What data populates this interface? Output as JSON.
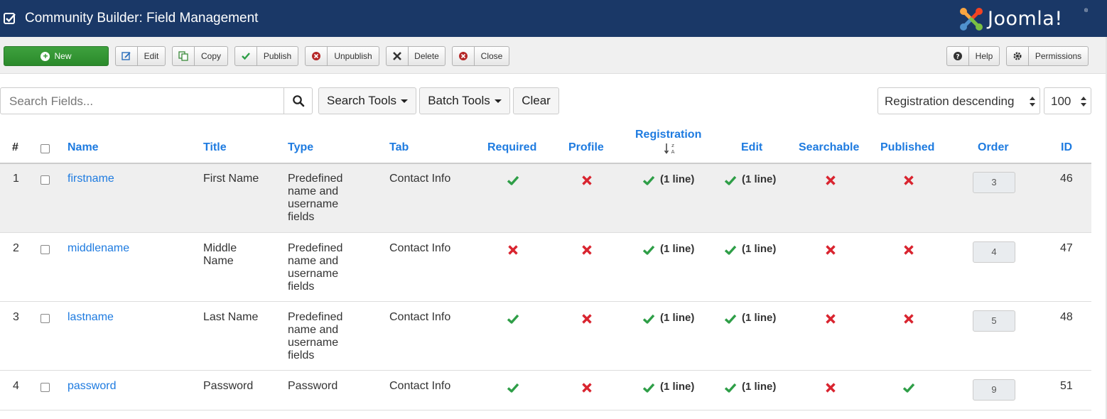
{
  "header": {
    "title": "Community Builder: Field Management",
    "logo_text": "Joomla!",
    "logo_reg": "®"
  },
  "toolbar": {
    "new": "New",
    "edit": "Edit",
    "copy": "Copy",
    "publish": "Publish",
    "unpublish": "Unpublish",
    "delete": "Delete",
    "close": "Close",
    "help": "Help",
    "permissions": "Permissions"
  },
  "filters": {
    "search_placeholder": "Search Fields...",
    "search_tools": "Search Tools",
    "batch_tools": "Batch Tools",
    "clear": "Clear",
    "ordering": "Registration descending",
    "limit": "100"
  },
  "table": {
    "columns": {
      "num": "#",
      "name": "Name",
      "title": "Title",
      "type": "Type",
      "tab": "Tab",
      "required": "Required",
      "profile": "Profile",
      "registration": "Registration",
      "edit": "Edit",
      "searchable": "Searchable",
      "published": "Published",
      "order": "Order",
      "id": "ID"
    },
    "rows": [
      {
        "num": "1",
        "name": "firstname",
        "title": "First Name",
        "type": "Predefined name and username fields",
        "tab": "Contact Info",
        "required": true,
        "profile": false,
        "registration": "(1 line)",
        "edit": "(1 line)",
        "searchable": false,
        "published": false,
        "order": "3",
        "id": "46"
      },
      {
        "num": "2",
        "name": "middlename",
        "title": "Middle Name",
        "type": "Predefined name and username fields",
        "tab": "Contact Info",
        "required": false,
        "profile": false,
        "registration": "(1 line)",
        "edit": "(1 line)",
        "searchable": false,
        "published": false,
        "order": "4",
        "id": "47"
      },
      {
        "num": "3",
        "name": "lastname",
        "title": "Last Name",
        "type": "Predefined name and username fields",
        "tab": "Contact Info",
        "required": true,
        "profile": false,
        "registration": "(1 line)",
        "edit": "(1 line)",
        "searchable": false,
        "published": false,
        "order": "5",
        "id": "48"
      },
      {
        "num": "4",
        "name": "password",
        "title": "Password",
        "type": "Password",
        "tab": "Contact Info",
        "required": true,
        "profile": false,
        "registration": "(1 line)",
        "edit": "(1 line)",
        "searchable": false,
        "published": true,
        "order": "9",
        "id": "51"
      }
    ]
  },
  "colors": {
    "header_bg": "#1a3867",
    "accent_link": "#1e7be0",
    "check_green": "#2e9e47",
    "cross_red": "#d9242f",
    "new_button": "#2f962f"
  }
}
